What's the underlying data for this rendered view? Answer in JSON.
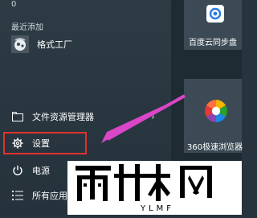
{
  "start_menu": {
    "top_item": {
      "label": "0"
    },
    "recently_added_title": "最近添加",
    "recent_app": {
      "label": "格式工厂"
    },
    "items": [
      {
        "key": "file-explorer",
        "label": "文件资源管理器",
        "has_chevron": true
      },
      {
        "key": "settings",
        "label": "设置",
        "highlighted": true
      },
      {
        "key": "power",
        "label": "电源"
      },
      {
        "key": "all-apps",
        "label": "所有应用"
      }
    ]
  },
  "tiles": [
    {
      "key": "baidu-cloud",
      "label": "百度云同步盘"
    },
    {
      "key": "360-browser",
      "label": "360极速浏览器"
    }
  ],
  "watermark": {
    "main_text": "雨林木风",
    "sub_text": "YLMF"
  },
  "colors": {
    "highlight_border": "#e0322d",
    "arrow": "#d946c8",
    "bg_dark": "#27343e",
    "tile": "#3b4a54"
  }
}
